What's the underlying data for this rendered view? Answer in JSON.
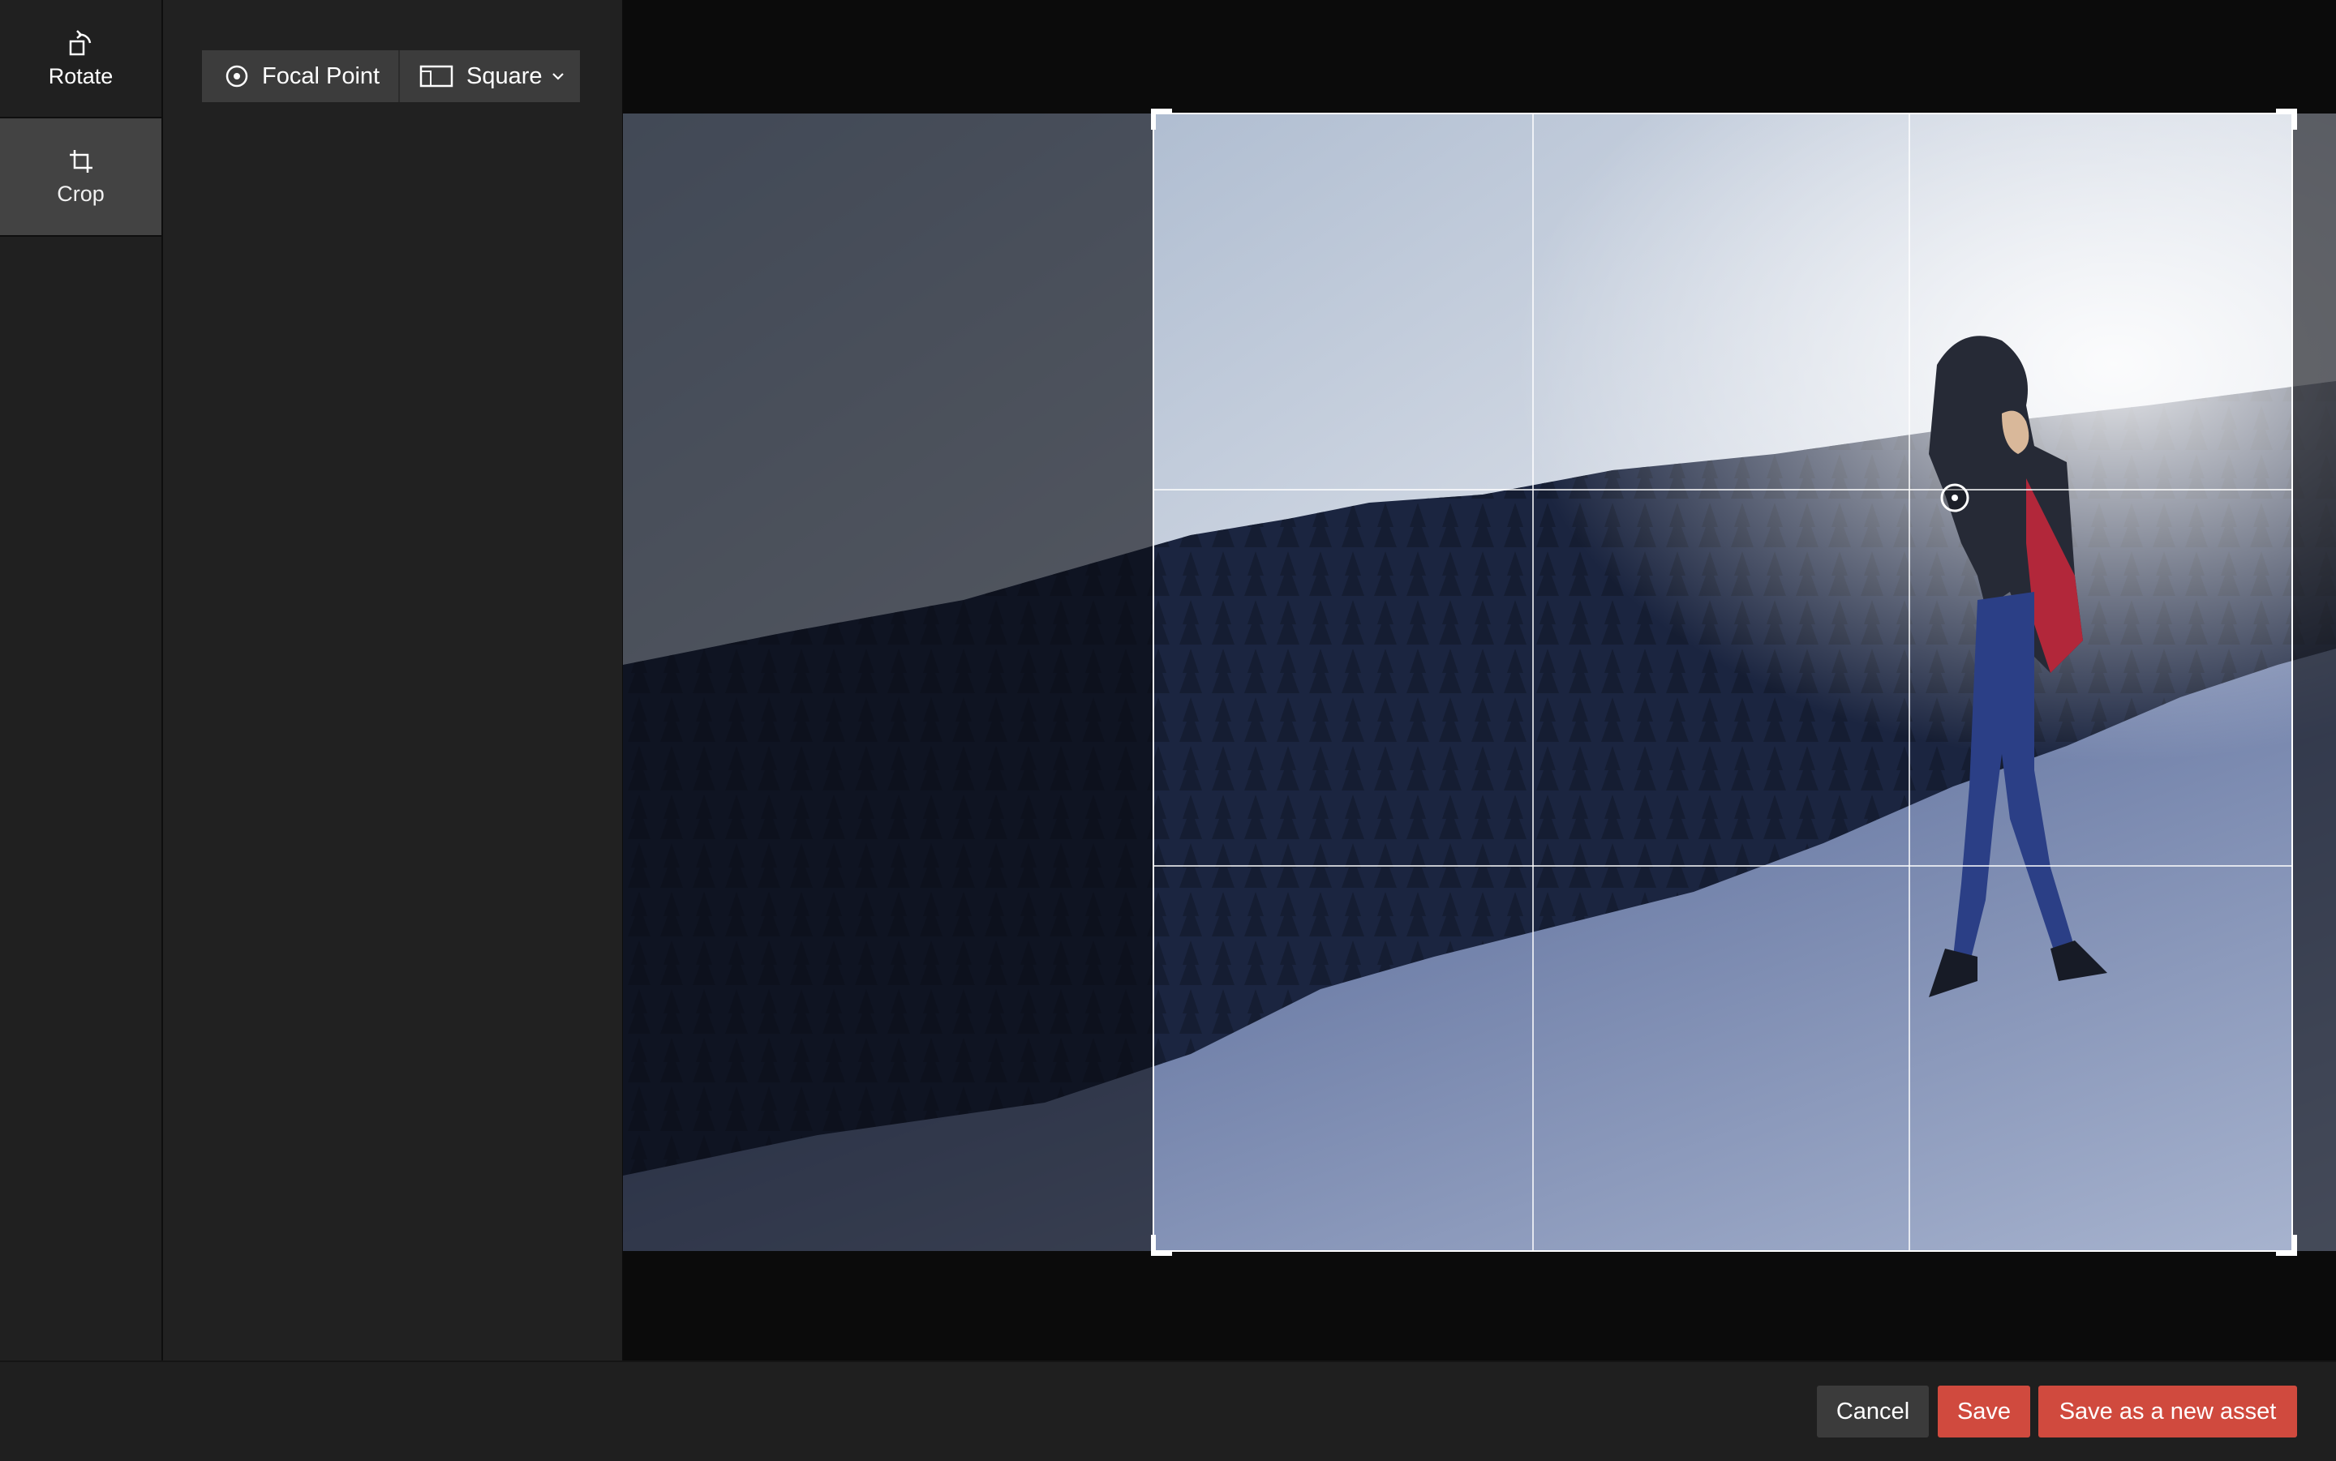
{
  "tools": {
    "rotate_label": "Rotate",
    "crop_label": "Crop"
  },
  "crop_options": {
    "focal_point_label": "Focal Point",
    "aspect_label": "Square"
  },
  "footer": {
    "cancel_label": "Cancel",
    "save_label": "Save",
    "save_new_label": "Save as a new asset"
  },
  "colors": {
    "accent": "#d04a3e",
    "panel": "#212121",
    "active_tool": "#434343"
  },
  "icons": [
    "rotate-icon",
    "crop-icon",
    "focal-point-icon",
    "aspect-ratio-icon",
    "chevron-down-icon"
  ]
}
